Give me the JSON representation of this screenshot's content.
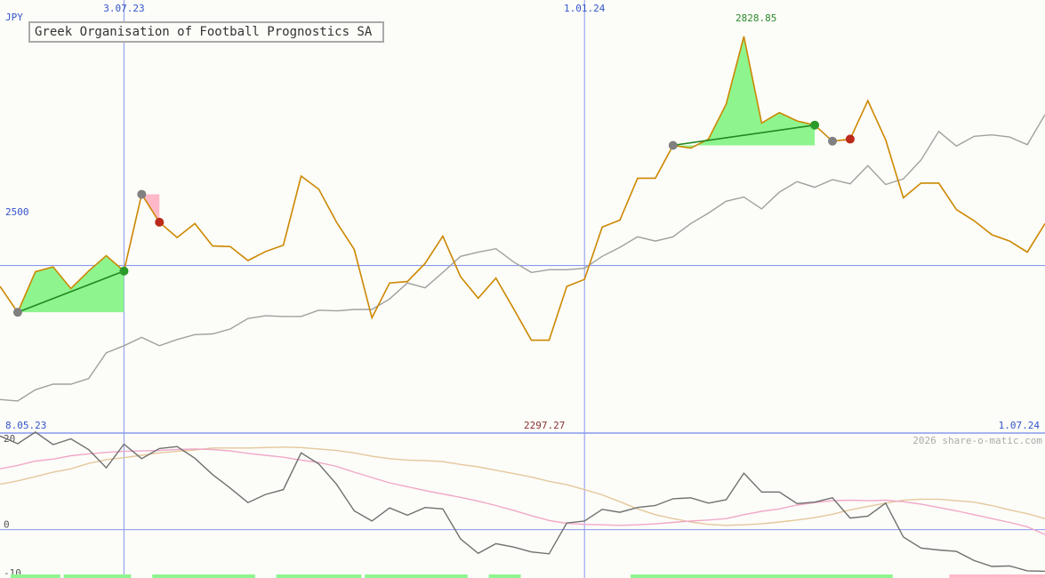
{
  "chart_data": [
    {
      "type": "line",
      "title": "Greek Organisation of Football Prognostics SA",
      "currency": "JPY",
      "ylabel": "",
      "xlabel": "",
      "y_reference": 2500,
      "y_reference_label": "2500",
      "ylim": [
        2260,
        2870
      ],
      "max_label": "2828.85",
      "min_label": "2297.27",
      "date_labels": [
        {
          "label": "3.07.23",
          "week": 7
        },
        {
          "label": "1.01.24",
          "week": 33
        }
      ],
      "start_date": "8.05.23",
      "end_date": "1.07.24",
      "grid": true,
      "series": [
        {
          "values": [
            2470,
            2433,
            2491,
            2498,
            2467,
            2492,
            2514,
            2492,
            2602,
            2562,
            2540,
            2560,
            2528,
            2527,
            2507,
            2520,
            2529,
            2628,
            2609,
            2562,
            2523,
            2425,
            2475,
            2477,
            2503,
            2542,
            2484,
            2453,
            2482,
            2438,
            2393,
            2393,
            2470,
            2480,
            2555,
            2565,
            2625,
            2625,
            2672,
            2668,
            2681,
            2731,
            2828,
            2704,
            2719,
            2707,
            2701,
            2678,
            2681,
            2736,
            2680,
            2597,
            2618,
            2618,
            2580,
            2564,
            2544,
            2535,
            2519,
            2560
          ]
        },
        {
          "values": [
            2308,
            2306,
            2322,
            2330,
            2330,
            2338,
            2375,
            2385,
            2397,
            2385,
            2394,
            2401,
            2402,
            2409,
            2424,
            2428,
            2427,
            2427,
            2436,
            2435,
            2437,
            2437,
            2452,
            2475,
            2468,
            2490,
            2513,
            2519,
            2524,
            2505,
            2490,
            2494,
            2494,
            2496,
            2513,
            2526,
            2541,
            2535,
            2541,
            2560,
            2575,
            2592,
            2598,
            2581,
            2605,
            2620,
            2612,
            2623,
            2617,
            2643,
            2616,
            2624,
            2651,
            2692,
            2671,
            2685,
            2687,
            2684,
            2673,
            2716
          ]
        }
      ],
      "signals": [
        {
          "type": "buy",
          "from": 1,
          "to": 7,
          "color": "#8ef58e"
        },
        {
          "type": "sell",
          "from": 8,
          "to": 9,
          "color": "#ffb8c8"
        },
        {
          "type": "buy",
          "from": 38,
          "to": 46,
          "color": "#8ef58e"
        },
        {
          "type": "sell",
          "from": 47,
          "to": 48,
          "color": "#ffb8c8"
        }
      ]
    },
    {
      "type": "line",
      "title": "",
      "ylim": [
        -10,
        20
      ],
      "y_ticks": [
        20,
        0,
        -10
      ],
      "series": [
        {
          "values": [
            19.4,
            17.8,
            20.2,
            17.6,
            18.8,
            16.6,
            12.8,
            17.7,
            14.7,
            16.8,
            17.2,
            14.8,
            11.4,
            8.6,
            5.6,
            7.3,
            8.3,
            15.9,
            13.6,
            9.4,
            3.9,
            1.8,
            4.5,
            3.0,
            4.6,
            4.3,
            -1.9,
            -4.9,
            -2.9,
            -3.6,
            -4.6,
            -5.0,
            1.4,
            1.8,
            4.2,
            3.6,
            4.6,
            5.0,
            6.4,
            6.6,
            5.5,
            6.2,
            11.7,
            7.8,
            7.8,
            5.4,
            5.7,
            6.6,
            2.4,
            2.8,
            5.5,
            -1.5,
            -3.8,
            -4.2,
            -4.5,
            -6.4,
            -7.6,
            -7.5,
            -8.5,
            -8.6
          ]
        },
        {
          "values": [
            12.6,
            13.3,
            14.2,
            14.6,
            15.3,
            15.7,
            16.0,
            16.2,
            16.3,
            16.4,
            16.6,
            16.7,
            16.6,
            16.3,
            15.8,
            15.4,
            15.0,
            14.4,
            13.9,
            13.1,
            11.9,
            10.8,
            9.7,
            8.9,
            8.1,
            7.4,
            6.7,
            5.9,
            5.0,
            4.0,
            2.9,
            1.9,
            1.3,
            1.1,
            1.0,
            0.9,
            1.0,
            1.2,
            1.5,
            1.8,
            2.0,
            2.3,
            3.1,
            3.8,
            4.3,
            5.1,
            5.6,
            6.0,
            6.1,
            6.0,
            6.1,
            5.8,
            5.3,
            4.6,
            3.9,
            3.1,
            2.3,
            1.5,
            0.6,
            -1.0
          ]
        },
        {
          "values": [
            9.4,
            10.1,
            11.0,
            11.9,
            12.6,
            13.7,
            14.5,
            14.9,
            15.4,
            15.9,
            16.2,
            16.5,
            16.9,
            16.9,
            16.9,
            17.0,
            17.1,
            17.0,
            16.7,
            16.4,
            15.9,
            15.2,
            14.7,
            14.4,
            14.3,
            14.1,
            13.5,
            13.0,
            12.3,
            11.6,
            10.9,
            10.0,
            9.3,
            8.3,
            7.2,
            5.8,
            4.3,
            3.1,
            2.3,
            1.6,
            1.1,
            0.9,
            1.0,
            1.2,
            1.6,
            2.0,
            2.5,
            3.2,
            4.1,
            4.8,
            5.5,
            6.1,
            6.3,
            6.3,
            6.0,
            5.7,
            5.0,
            4.1,
            3.3,
            2.3
          ]
        }
      ],
      "volume_signal_bars": [
        {
          "from": 1,
          "to": 3,
          "color": "#8ef58e"
        },
        {
          "from": 4,
          "to": 7,
          "color": "#8ef58e"
        },
        {
          "from": 9,
          "to": 14,
          "color": "#8ef58e"
        },
        {
          "from": 16,
          "to": 20,
          "color": "#8ef58e"
        },
        {
          "from": 21,
          "to": 26,
          "color": "#8ef58e"
        },
        {
          "from": 28,
          "to": 29,
          "color": "#8ef58e"
        },
        {
          "from": 36,
          "to": 50,
          "color": "#8ef58e"
        },
        {
          "from": 54,
          "to": 59,
          "color": "#ffb8c8"
        }
      ]
    }
  ],
  "watermark": "2026 share-o-matic.com",
  "colors": {
    "price": "#cc8800",
    "benchmark": "#a0a0a0",
    "osc1": "#707070",
    "osc2": "#f0a8c8",
    "osc3": "#e4c89c",
    "grid": "#8899ee",
    "label_blue": "#3355cc",
    "label_green": "#2a8a2a",
    "label_red": "#883333"
  }
}
